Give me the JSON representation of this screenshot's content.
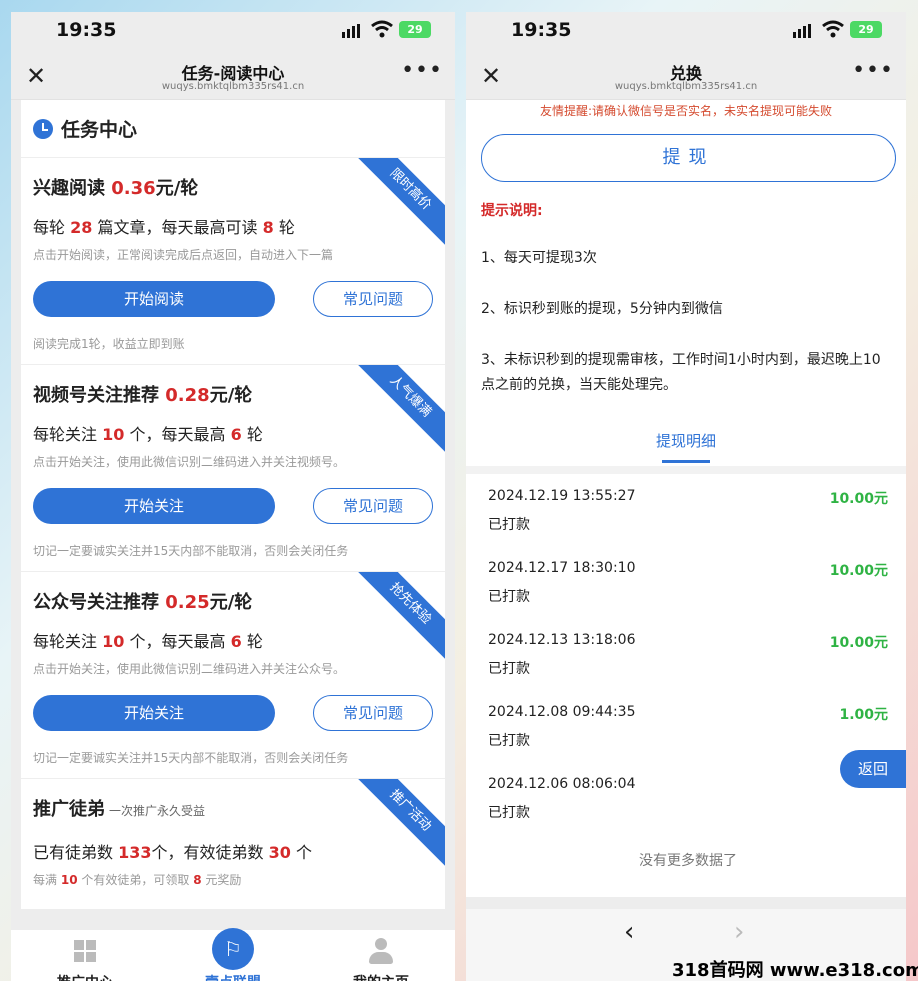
{
  "left": {
    "status_time": "19:35",
    "battery": "29",
    "nav_title": "任务-阅读中心",
    "nav_url": "wuqys.bmktqlbm335rs41.cn",
    "section_title": "任务中心",
    "tasks": [
      {
        "ribbon": "限时高价",
        "title": "兴趣阅读",
        "price": "0.36",
        "unit": "元/轮",
        "line_a": "每轮",
        "num_a": "28",
        "line_b": "篇文章，每天最高可读",
        "num_b": "8",
        "line_c": "轮",
        "desc": "点击开始阅读，正常阅读完成后点返回，自动进入下一篇",
        "primary": "开始阅读",
        "secondary": "常见问题",
        "note": "阅读完成1轮，收益立即到账"
      },
      {
        "ribbon": "人气爆满",
        "title": "视频号关注推荐",
        "price": "0.28",
        "unit": "元/轮",
        "line_a": "每轮关注",
        "num_a": "10",
        "line_b": "个，每天最高",
        "num_b": "6",
        "line_c": "轮",
        "desc": "点击开始关注，使用此微信识别二维码进入并关注视频号。",
        "primary": "开始关注",
        "secondary": "常见问题",
        "note": "切记一定要诚实关注并15天内部不能取消，否则会关闭任务"
      },
      {
        "ribbon": "抢先体验",
        "title": "公众号关注推荐",
        "price": "0.25",
        "unit": "元/轮",
        "line_a": "每轮关注",
        "num_a": "10",
        "line_b": "个，每天最高",
        "num_b": "6",
        "line_c": "轮",
        "desc": "点击开始关注，使用此微信识别二维码进入并关注公众号。",
        "primary": "开始关注",
        "secondary": "常见问题",
        "note": "切记一定要诚实关注并15天内部不能取消，否则会关闭任务"
      }
    ],
    "promo": {
      "ribbon": "推广活动",
      "title": "推广徒弟",
      "subtitle": "一次推广永久受益",
      "line_a": "已有徒弟数",
      "num_a": "133",
      "line_b": "个，有效徒弟数",
      "num_b": "30",
      "line_c": "个",
      "desc_a": "每满",
      "desc_num_a": "10",
      "desc_b": "个有效徒弟，可领取",
      "desc_num_b": "8",
      "desc_c": "元奖励"
    },
    "tabs": [
      {
        "label": "推广中心",
        "icon": "windows-icon"
      },
      {
        "label": "壹点联盟",
        "icon": "flag-icon"
      },
      {
        "label": "我的主页",
        "icon": "user-icon"
      }
    ]
  },
  "right": {
    "status_time": "19:35",
    "battery": "29",
    "nav_title": "兑换",
    "nav_url": "wuqys.bmktqlbm335rs41.cn",
    "warning": "友情提醒:请确认微信号是否实名，未实名提现可能失败",
    "withdraw_label": "提现",
    "tip_title": "提示说明:",
    "tips": [
      "1、每天可提现3次",
      "2、标识秒到账的提现，5分钟内到微信",
      "3、未标识秒到的提现需审核，工作时间1小时内到，最迟晚上10点之前的兑换，当天能处理完。"
    ],
    "detail_tab": "提现明细",
    "records": [
      {
        "date": "2024.12.19 13:55:27",
        "amount": "10.00元",
        "status": "已打款"
      },
      {
        "date": "2024.12.17 18:30:10",
        "amount": "10.00元",
        "status": "已打款"
      },
      {
        "date": "2024.12.13 13:18:06",
        "amount": "10.00元",
        "status": "已打款"
      },
      {
        "date": "2024.12.08 09:44:35",
        "amount": "1.00元",
        "status": "已打款"
      },
      {
        "date": "2024.12.06 08:06:04",
        "amount": "",
        "status": "已打款"
      }
    ],
    "no_more": "没有更多数据了",
    "back_label": "返回"
  },
  "watermark": "318首码网 www.e318.com",
  "colors": {
    "accent": "#2f73d6",
    "price_red": "#d42a2a",
    "amount_green": "#2fb344"
  }
}
